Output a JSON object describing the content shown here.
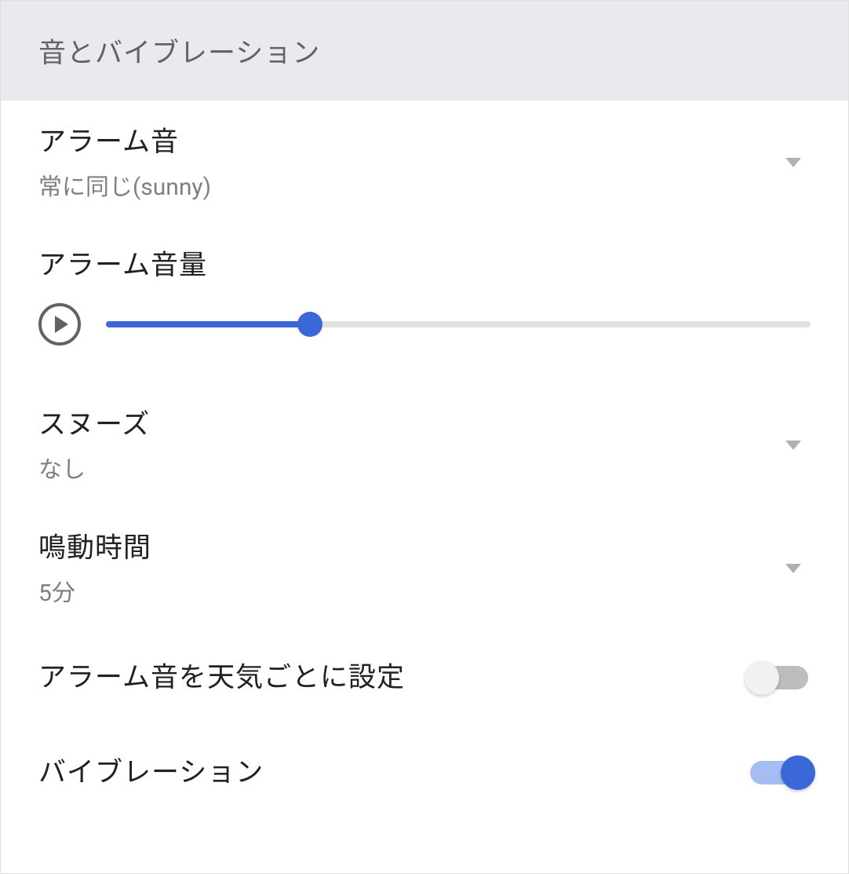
{
  "section": {
    "title": "音とバイブレーション"
  },
  "alarm_sound": {
    "label": "アラーム音",
    "value": "常に同じ(sunny)"
  },
  "alarm_volume": {
    "label": "アラーム音量",
    "percent": 29
  },
  "snooze": {
    "label": "スヌーズ",
    "value": "なし"
  },
  "ring_duration": {
    "label": "鳴動時間",
    "value": "5分"
  },
  "weather_sound": {
    "label": "アラーム音を天気ごとに設定",
    "enabled": false
  },
  "vibration": {
    "label": "バイブレーション",
    "enabled": true
  }
}
